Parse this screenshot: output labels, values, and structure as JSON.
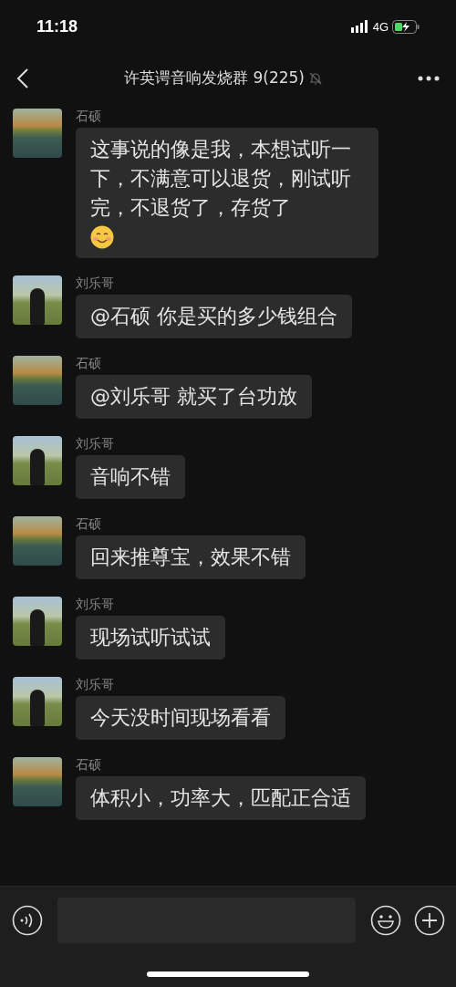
{
  "status_bar": {
    "time": "11:18",
    "network": "4G"
  },
  "header": {
    "title": "许英谔音响发烧群 9(225)",
    "muted": true
  },
  "messages": [
    {
      "sender": "石硕",
      "avatar": {
        "kind": "landscape"
      },
      "text": "这事说的像是我，本想试听一下，不满意可以退货，刚试听完，不退货了，存货了",
      "kind": "text_emoji"
    },
    {
      "sender": "刘乐哥",
      "avatar": {
        "kind": "portrait"
      },
      "text": "@石硕 你是买的多少钱组合",
      "kind": "text"
    },
    {
      "sender": "石硕",
      "avatar": {
        "kind": "landscape"
      },
      "text": "@刘乐哥 就买了台功放",
      "kind": "text"
    },
    {
      "sender": "刘乐哥",
      "avatar": {
        "kind": "portrait"
      },
      "text": "音响不错",
      "kind": "text"
    },
    {
      "sender": "石硕",
      "avatar": {
        "kind": "landscape"
      },
      "text": "回来推尊宝，效果不错",
      "kind": "text"
    },
    {
      "sender": "刘乐哥",
      "avatar": {
        "kind": "portrait"
      },
      "text": "现场试听试试",
      "kind": "text"
    },
    {
      "sender": "刘乐哥",
      "avatar": {
        "kind": "portrait"
      },
      "text": "今天没时间现场看看",
      "kind": "text"
    },
    {
      "sender": "石硕",
      "avatar": {
        "kind": "landscape"
      },
      "text": "体积小，功率大，匹配正合适",
      "kind": "text"
    }
  ]
}
